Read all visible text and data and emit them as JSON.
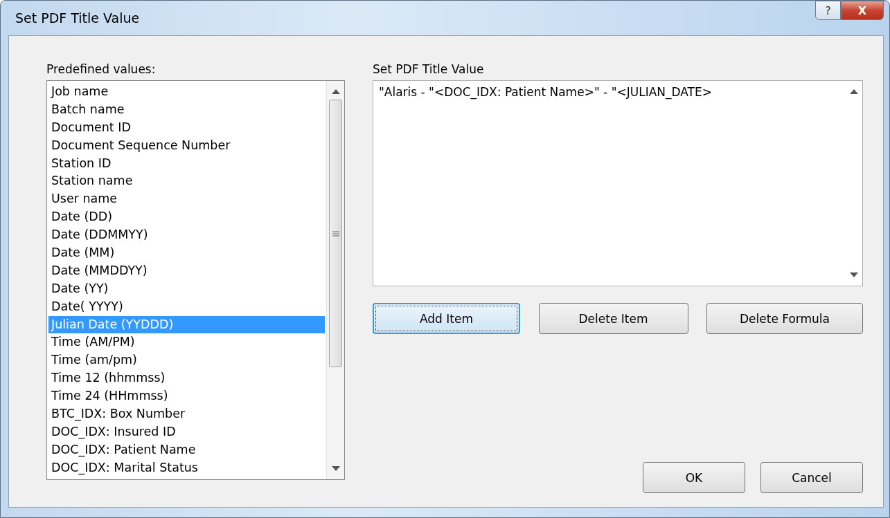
{
  "window": {
    "title": "Set PDF Title Value",
    "help_button": "?",
    "close_button": "X"
  },
  "predefined": {
    "label": "Predefined values:",
    "items": [
      {
        "label": "Job name",
        "selected": false
      },
      {
        "label": "Batch name",
        "selected": false
      },
      {
        "label": "Document ID",
        "selected": false
      },
      {
        "label": "Document Sequence Number",
        "selected": false
      },
      {
        "label": "Station ID",
        "selected": false
      },
      {
        "label": "Station name",
        "selected": false
      },
      {
        "label": "User name",
        "selected": false
      },
      {
        "label": "Date (DD)",
        "selected": false
      },
      {
        "label": "Date (DDMMYY)",
        "selected": false
      },
      {
        "label": "Date (MM)",
        "selected": false
      },
      {
        "label": "Date (MMDDYY)",
        "selected": false
      },
      {
        "label": "Date (YY)",
        "selected": false
      },
      {
        "label": "Date( YYYY)",
        "selected": false
      },
      {
        "label": "Julian Date (YYDDD)",
        "selected": true
      },
      {
        "label": "Time (AM/PM)",
        "selected": false
      },
      {
        "label": "Time (am/pm)",
        "selected": false
      },
      {
        "label": "Time 12 (hhmmss)",
        "selected": false
      },
      {
        "label": "Time 24 (HHmmss)",
        "selected": false
      },
      {
        "label": "BTC_IDX: Box Number",
        "selected": false
      },
      {
        "label": "DOC_IDX: Insured ID",
        "selected": false
      },
      {
        "label": "DOC_IDX: Patient Name",
        "selected": false
      },
      {
        "label": "DOC_IDX: Marital Status",
        "selected": false
      }
    ]
  },
  "formula": {
    "label": "Set PDF Title Value",
    "value": "\"Alaris - \"<DOC_IDX: Patient Name>\" - \"<JULIAN_DATE>"
  },
  "buttons": [
    {
      "label": "Add Item",
      "focused": true
    },
    {
      "label": "Delete Item",
      "focused": false
    },
    {
      "label": "Delete Formula",
      "focused": false
    }
  ],
  "footer_buttons": [
    {
      "label": "OK"
    },
    {
      "label": "Cancel"
    }
  ]
}
